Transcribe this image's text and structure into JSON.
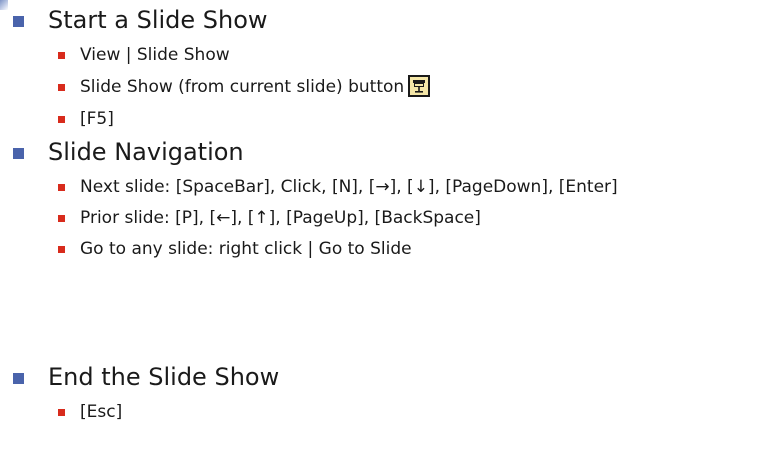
{
  "sections": [
    {
      "title": "Start a Slide Show",
      "items": [
        "View | Slide Show",
        "Slide Show (from current slide) button",
        "[F5]"
      ]
    },
    {
      "title": "Slide Navigation",
      "items": [
        "Next slide: [SpaceBar], Click, [N], [→], [↓], [PageDown], [Enter]",
        "Prior slide: [P], [←], [↑], [PageUp], [BackSpace]",
        "Go to any slide: right click | Go to Slide"
      ]
    },
    {
      "title": "End the Slide Show",
      "items": [
        "[Esc]"
      ]
    }
  ],
  "icons": {
    "slide_show_button": "slide-show-icon"
  },
  "colors": {
    "main_bullet": "#4a63ab",
    "sub_bullet": "#d82b1c",
    "text": "#1a1a1a",
    "button_fill": "#f5e7a8"
  }
}
